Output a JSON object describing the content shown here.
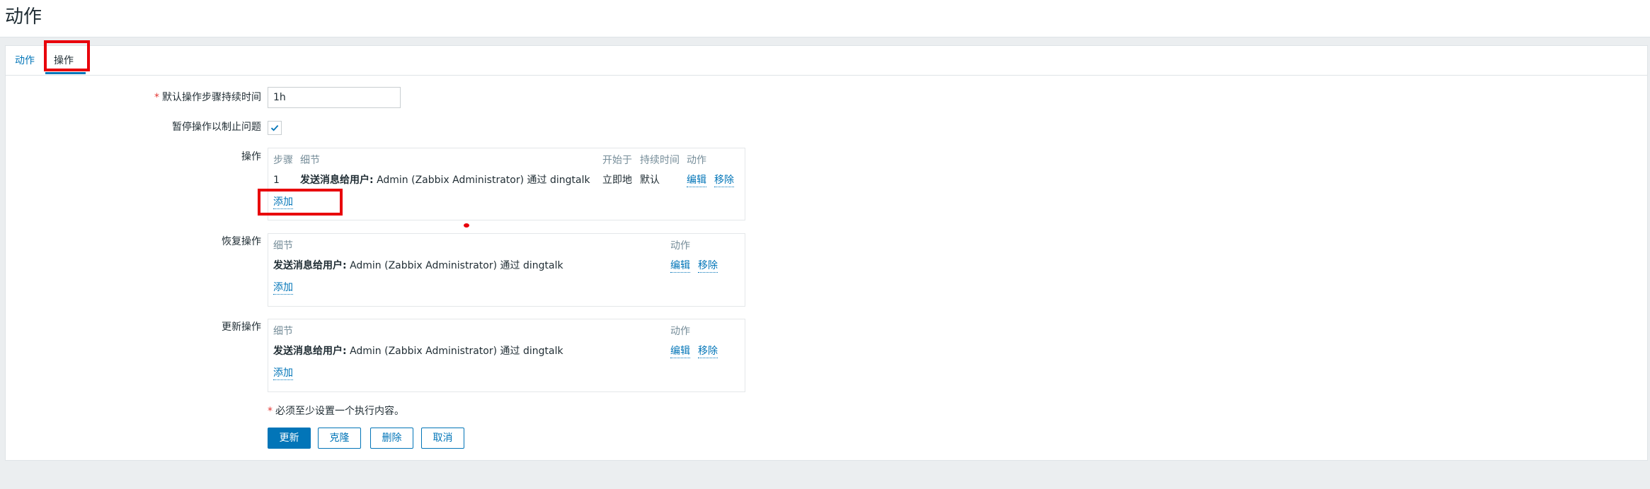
{
  "page": {
    "title": "动作"
  },
  "tabs": [
    {
      "label": "动作"
    },
    {
      "label": "操作"
    }
  ],
  "form": {
    "default_step_duration": {
      "label": "默认操作步骤持续时间",
      "value": "1h"
    },
    "pause_operations": {
      "label": "暂停操作以制止问题",
      "checked": true
    },
    "operations": {
      "label": "操作",
      "headers": {
        "step": "步骤",
        "details": "细节",
        "start_in": "开始于",
        "duration": "持续时间",
        "action": "动作"
      },
      "rows": [
        {
          "step": "1",
          "detail_bold": "发送消息给用户:",
          "detail_rest": "Admin (Zabbix Administrator) 通过 dingtalk",
          "start_in": "立即地",
          "duration": "默认",
          "edit": "编辑",
          "remove": "移除"
        }
      ],
      "add": "添加"
    },
    "recovery_operations": {
      "label": "恢复操作",
      "headers": {
        "details": "细节",
        "action": "动作"
      },
      "rows": [
        {
          "detail_bold": "发送消息给用户:",
          "detail_rest": "Admin (Zabbix Administrator) 通过 dingtalk",
          "edit": "编辑",
          "remove": "移除"
        }
      ],
      "add": "添加"
    },
    "update_operations": {
      "label": "更新操作",
      "headers": {
        "details": "细节",
        "action": "动作"
      },
      "rows": [
        {
          "detail_bold": "发送消息给用户:",
          "detail_rest": "Admin (Zabbix Administrator) 通过 dingtalk",
          "edit": "编辑",
          "remove": "移除"
        }
      ],
      "add": "添加"
    },
    "footnote": "必须至少设置一个执行内容。"
  },
  "buttons": {
    "update": "更新",
    "clone": "克隆",
    "delete": "删除",
    "cancel": "取消"
  },
  "colors": {
    "accent": "#0275b8",
    "highlight": "#e8000b",
    "required": "#e33734"
  }
}
